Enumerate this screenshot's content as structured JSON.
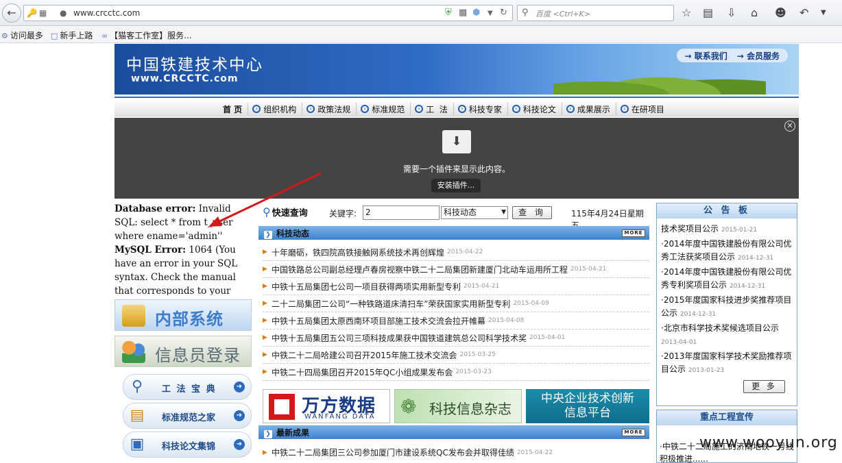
{
  "browser": {
    "url": "www.crcctc.com",
    "search_placeholder": "百度 <Ctrl+K>",
    "bookmarks": [
      "访问最多",
      "新手上路",
      "【猫客工作室】服务..."
    ]
  },
  "banner": {
    "title_cn": "中国铁建技术中心",
    "title_en": "www.CRCCTC.com",
    "links": [
      "→ 联系我们",
      "→ 会员服务"
    ]
  },
  "nav": {
    "home": "首 页",
    "items": [
      "组织机构",
      "政策法规",
      "标准规范",
      "工  法",
      "科技专家",
      "科技论文",
      "成果展示",
      "在研项目"
    ]
  },
  "plugin": {
    "message": "需要一个插件来显示此内容。",
    "install_label": "安装插件..."
  },
  "error": {
    "line1_bold": "Database error:",
    "line1_rest": " Invalid SQL: select * from t_user where ename='admin''",
    "line2_bold": "MySQL Error:",
    "line2_rest": " 1064 (You have an error in your SQL syntax. Check the manual that corresponds to your"
  },
  "sidebar": {
    "buttons": [
      "内部系统",
      "信息员登录"
    ],
    "pills": [
      "工 法 宝 典",
      "标准规范之家",
      "科技论文集锦"
    ]
  },
  "quick_search": {
    "title": "快速查询",
    "keyword_label": "关键字:",
    "keyword_value": "2",
    "category_value": "科技动态",
    "button_label": "查 询",
    "date": "115年4月24日星期五"
  },
  "tech_news": {
    "title": "科技动态",
    "more": "MORE",
    "items": [
      {
        "title": "十年磨砺，铁四院高铁接触网系统技术再创辉煌",
        "date": "2015-04-22"
      },
      {
        "title": "中国铁路总公司副总经理卢春房视察中铁二十二局集团新建厦门北动车运用所工程",
        "date": "2015-04-21"
      },
      {
        "title": "中铁十五局集团七公司一项目获得两项实用新型专利",
        "date": "2015-04-21"
      },
      {
        "title": "二十二局集团二公司“一种铁路道床清扫车”荣获国家实用新型专利",
        "date": "2015-04-09"
      },
      {
        "title": "中铁十五局集团太原西南环项目部施工技术交流会拉开帷幕",
        "date": "2015-04-08"
      },
      {
        "title": "中铁十五局集团五公司三项科技成果获中国铁道建筑总公司科学技术奖",
        "date": "2015-04-01"
      },
      {
        "title": "中铁二十二局哈建公司召开2015年施工技术交流会",
        "date": "2015-03-25"
      },
      {
        "title": "中铁二十四局集团召开2015年QC小组成果发布会",
        "date": "2015-03-23"
      }
    ]
  },
  "ads": {
    "wanfang": "万方数据",
    "wanfang_en": "WANFANG DATA",
    "magazine": "科技信息杂志",
    "platform": "中央企业技术创新信息平台"
  },
  "latest": {
    "title": "最新成果",
    "more": "MORE",
    "items": [
      {
        "title": "中铁二十二局集团三公司参加厦门市建设系统QC发布会并取得佳绩",
        "date": "2015-04-22"
      }
    ]
  },
  "notice": {
    "title": "公 告 板",
    "items": [
      {
        "title": "技术奖项目公示",
        "date": "2015-01-21"
      },
      {
        "title": "·2014年度中国铁建股份有限公司优秀工法获奖项目公示",
        "date": "2014-12-31"
      },
      {
        "title": "·2014年度中国铁建股份有限公司优秀专利奖项目公示",
        "date": "2014-12-31"
      },
      {
        "title": "·2015年度国家科技进步奖推荐项目公示",
        "date": "2014-12-31"
      },
      {
        "title": "·北京市科学技术奖候选项目公示",
        "date": "2013-04-01"
      },
      {
        "title": "·2013年度国家科学技术奖励推荐项目公示",
        "date": "2013-01-23"
      }
    ],
    "more_label": "更 多"
  },
  "project": {
    "title": "重点工程宣传",
    "text": "·中铁二十二局施工的济南地铁一号线积极推进......"
  },
  "watermark": "www.wooyun.org"
}
